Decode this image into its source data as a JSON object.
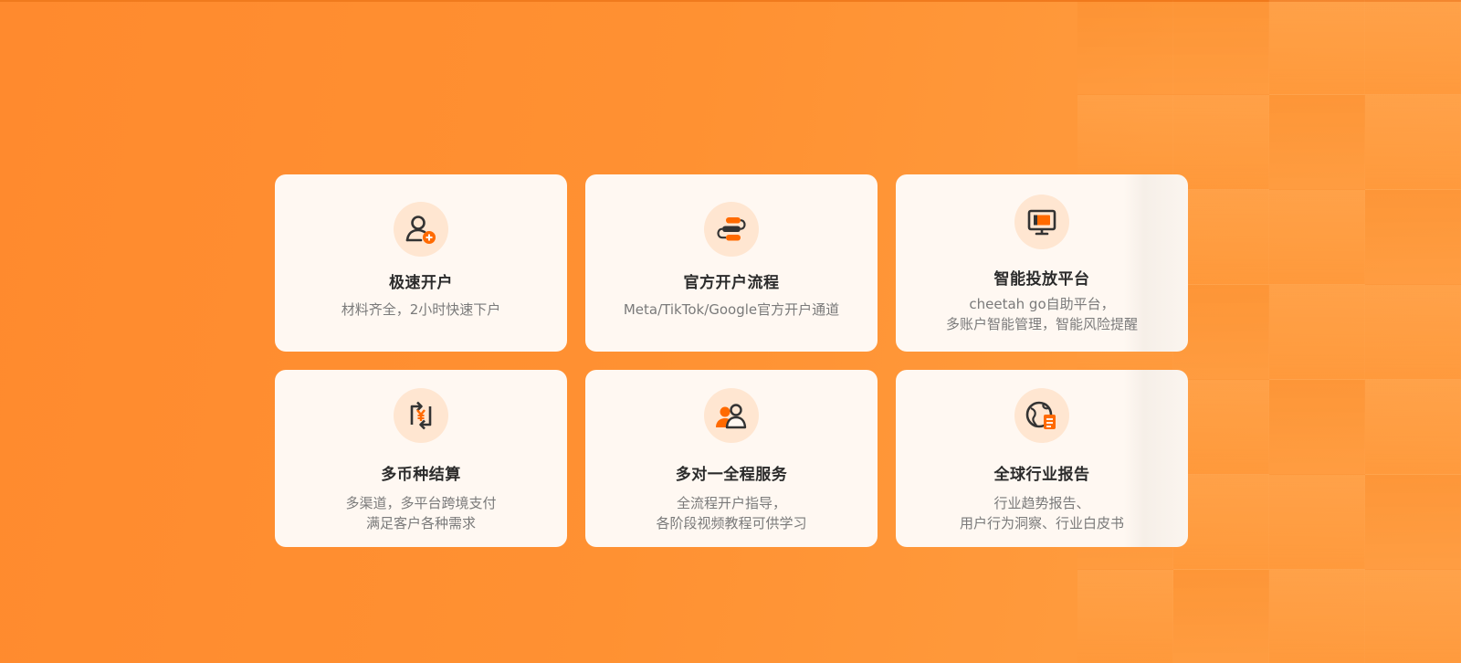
{
  "features": [
    {
      "icon": "user-add-icon",
      "title": "极速开户",
      "desc": [
        "材料齐全，2小时快速下户"
      ]
    },
    {
      "icon": "flow-process-icon",
      "title": "官方开户流程",
      "desc": [
        "Meta/TikTok/Google官方开户通道"
      ]
    },
    {
      "icon": "monitor-icon",
      "title": "智能投放平台",
      "desc": [
        "cheetah go自助平台，",
        "多账户智能管理，智能风险提醒"
      ]
    },
    {
      "icon": "currency-exchange-icon",
      "title": "多币种结算",
      "desc": [
        "多渠道，多平台跨境支付",
        "满足客户各种需求"
      ]
    },
    {
      "icon": "team-service-icon",
      "title": "多对一全程服务",
      "desc": [
        "全流程开户指导，",
        "各阶段视频教程可供学习"
      ]
    },
    {
      "icon": "global-report-icon",
      "title": "全球行业报告",
      "desc": [
        "行业趋势报告、",
        "用户行为洞察、行业白皮书"
      ]
    }
  ],
  "colors": {
    "accent": "#ff6a00",
    "icon_dark": "#333333",
    "icon_bg": "#ffe6d1",
    "card_bg": "#fff8f2"
  }
}
